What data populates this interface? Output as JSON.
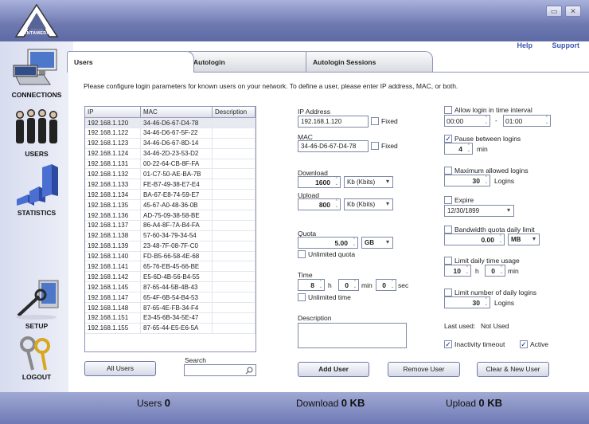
{
  "window": {
    "brand": "ANTAMEDIA",
    "minimize_glyph": "▭",
    "close_glyph": "✕"
  },
  "header": {
    "help": "Help",
    "support": "Support"
  },
  "sidebar": {
    "items": [
      {
        "label": "CONNECTIONS"
      },
      {
        "label": "USERS"
      },
      {
        "label": "STATISTICS"
      },
      {
        "label": "SETUP"
      },
      {
        "label": "LOGOUT"
      }
    ]
  },
  "tabs": [
    {
      "label": "Users"
    },
    {
      "label": "Autologin"
    },
    {
      "label": "Autologin Sessions"
    }
  ],
  "intro": "Please configure login parameters for known users on your network. To define a user, please enter IP address, MAC, or both.",
  "table": {
    "headers": [
      "IP",
      "MAC",
      "Description"
    ],
    "rows": [
      [
        "192.168.1.120",
        "34-46-D6-67-D4-78",
        ""
      ],
      [
        "192.168.1.122",
        "34-46-D6-67-5F-22",
        ""
      ],
      [
        "192.168.1.123",
        "34-46-D6-67-8D-14",
        ""
      ],
      [
        "192.168.1.124",
        "34-46-2D-23-53-D2",
        ""
      ],
      [
        "192.168.1.131",
        "00-22-64-CB-8F-FA",
        ""
      ],
      [
        "192.168.1.132",
        "01-C7-50-AE-BA-7B",
        ""
      ],
      [
        "192.168.1.133",
        "FE-B7-49-38-E7-E4",
        ""
      ],
      [
        "192.168.1.134",
        "BA-67-E8-74-59-E7",
        ""
      ],
      [
        "192.168.1.135",
        "45-67-A0-48-36-0B",
        ""
      ],
      [
        "192.168.1.136",
        "AD-75-09-38-58-BE",
        ""
      ],
      [
        "192.168.1.137",
        "86-A4-8F-7A-B4-FA",
        ""
      ],
      [
        "192.168.1.138",
        "57-60-34-79-34-54",
        ""
      ],
      [
        "192.168.1.139",
        "23-48-7F-08-7F-C0",
        ""
      ],
      [
        "192.168.1.140",
        "FD-B5-66-58-4E-68",
        ""
      ],
      [
        "192.168.1.141",
        "65-76-EB-45-66-BE",
        ""
      ],
      [
        "192.168.1.142",
        "E5-6D-4B-56-B4-55",
        ""
      ],
      [
        "192.168.1.145",
        "87-65-44-5B-4B-43",
        ""
      ],
      [
        "192.168.1.147",
        "65-4F-6B-54-B4-53",
        ""
      ],
      [
        "192.168.1.148",
        "87-65-4E-FB-34-F4",
        ""
      ],
      [
        "192.168.1.151",
        "E3-45-6B-34-5E-47",
        ""
      ],
      [
        "192.168.1.155",
        "87-65-44-E5-E6-5A",
        ""
      ]
    ]
  },
  "form": {
    "ip_label": "IP Address",
    "ip_value": "192.168.1.120",
    "fixed": "Fixed",
    "mac_label": "MAC",
    "mac_value": "34-46-D6-67-D4-78",
    "download_label": "Download",
    "download_value": "1600",
    "download_unit": "Kb (Kbits)",
    "upload_label": "Upload",
    "upload_value": "800",
    "upload_unit": "Kb (Kbits)",
    "quota_label": "Quota",
    "quota_value": "5.00",
    "quota_unit": "GB",
    "unlimited_quota": "Unlimited quota",
    "time_label": "Time",
    "time_h": "8",
    "h": "h",
    "time_min": "0",
    "min": "min",
    "time_sec": "0",
    "sec": "sec",
    "unlimited_time": "Unlimited time",
    "description_label": "Description"
  },
  "options": {
    "allow_interval": "Allow login in time interval",
    "from": "00:00",
    "dash": "-",
    "to": "01:00",
    "pause": "Pause between logins",
    "pause_value": "4",
    "pause_unit": "min",
    "max_logins": "Maximum allowed logins",
    "max_value": "30",
    "logins": "Logins",
    "expire": "Expire",
    "expire_value": "12/30/1899",
    "bw_limit": "Bandwidth quota daily limit",
    "bw_value": "0.00",
    "bw_unit": "MB",
    "time_usage": "Limit daily time usage",
    "tu_h": "10",
    "h": "h",
    "tu_min": "0",
    "min": "min",
    "daily_logins": "Limit number of daily logins",
    "dl_value": "30",
    "dl_unit": "Logins",
    "last_used": "Last used:",
    "last_used_value": "Not Used",
    "inactivity": "Inactivity timeout",
    "active": "Active"
  },
  "buttons": {
    "all_users": "All Users",
    "search_label": "Search",
    "add_user": "Add User",
    "remove_user": "Remove User",
    "clear_new": "Clear & New User"
  },
  "footer": {
    "users_label": "Users",
    "users_value": "0",
    "download_label": "Download",
    "download_value": "0 KB",
    "upload_label": "Upload",
    "upload_value": "0 KB"
  }
}
